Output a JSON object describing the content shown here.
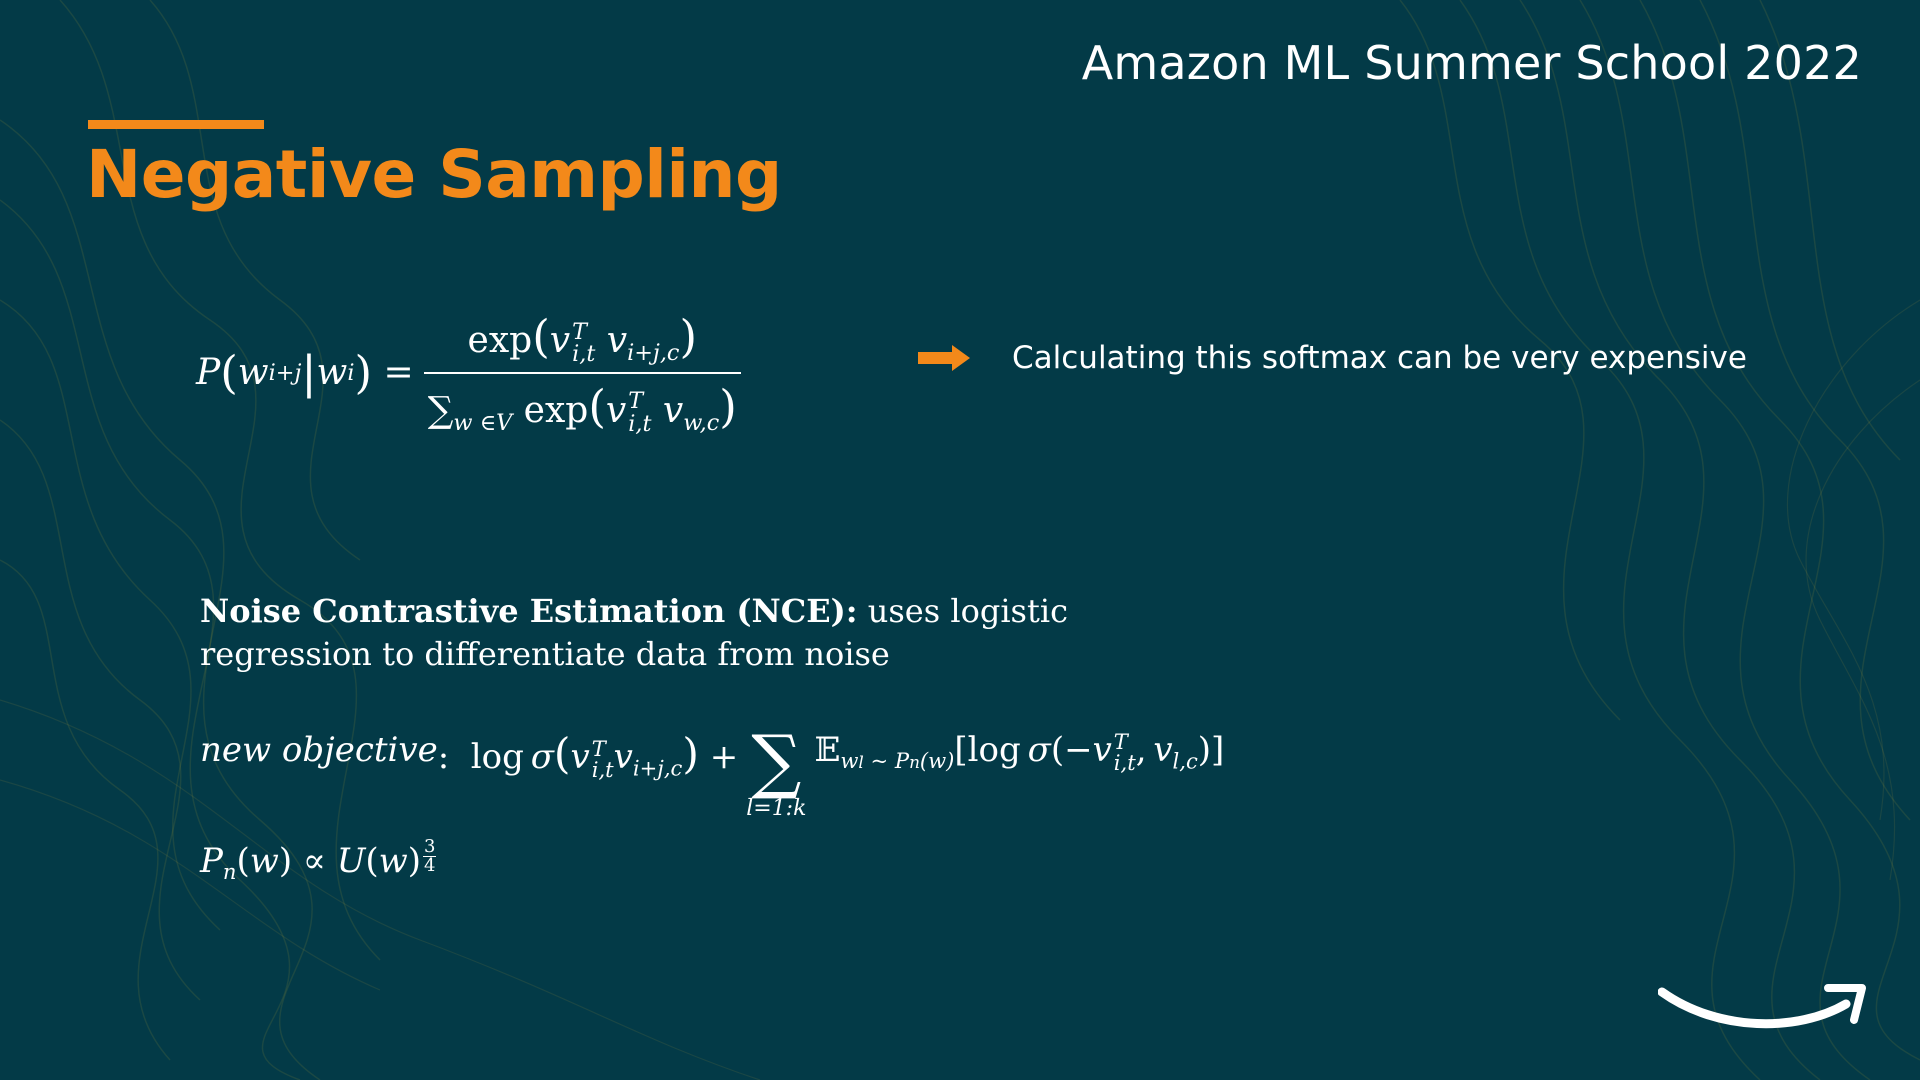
{
  "slide": {
    "header": "Amazon ML Summer School 2022",
    "title": "Negative Sampling",
    "softmax_note": "Calculating this softmax can be very expensive",
    "nce_bold": "Noise Contrastive Estimation (NCE):",
    "nce_rest": " uses logistic regression to differentiate data from noise",
    "objective_label": "new objective",
    "sum_limits": "l=1:k",
    "colors": {
      "background": "#033a47",
      "accent": "#f3891a",
      "text": "#ffffff"
    },
    "icons": [
      "arrow-right-icon",
      "amazon-smile-logo"
    ]
  }
}
